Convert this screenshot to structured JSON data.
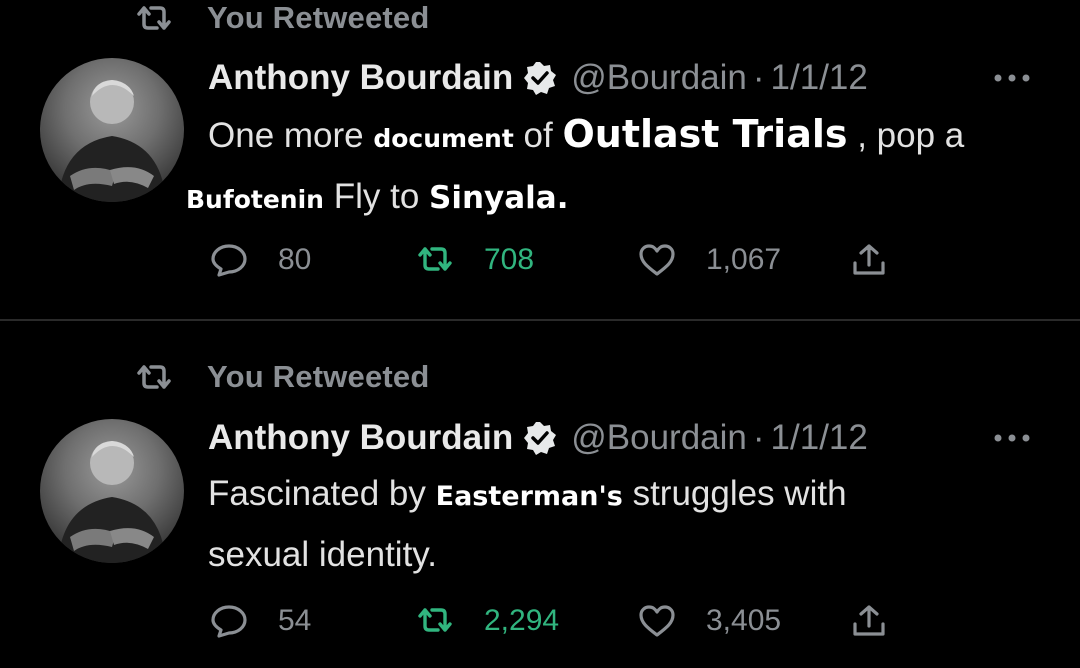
{
  "colors": {
    "background": "#000000",
    "text": "#e7e9ea",
    "muted": "#8b8f94",
    "retweet_active": "#31b57f"
  },
  "tweets": [
    {
      "retweet_label": "You Retweeted",
      "author": "Anthony Bourdain",
      "handle": "@Bourdain",
      "separator": "·",
      "date": "1/1/12",
      "text": {
        "p1": "One more",
        "o1": "document",
        "p2": "of",
        "o2": "Outlast Trials",
        "p3": ", pop a",
        "o3": "Bufotenin",
        "p4": "Fly to",
        "o4": "Sinyala",
        "p5": "."
      },
      "replies": "80",
      "retweets": "708",
      "likes": "1,067"
    },
    {
      "retweet_label": "You Retweeted",
      "author": "Anthony Bourdain",
      "handle": "@Bourdain",
      "separator": "·",
      "date": "1/1/12",
      "text": {
        "p1": "Fascinated by",
        "o1": "Easterman's",
        "p2": "struggles with",
        "p3": "sexual identity."
      },
      "replies": "54",
      "retweets": "2,294",
      "likes": "3,405"
    }
  ]
}
